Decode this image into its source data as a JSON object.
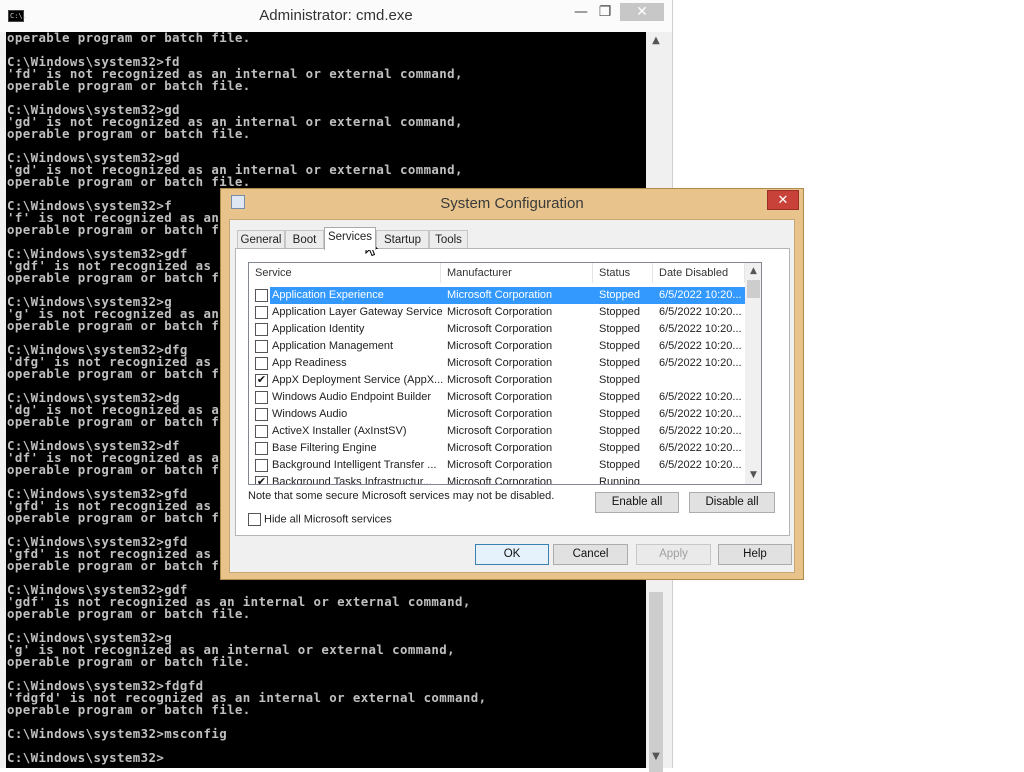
{
  "cmd": {
    "title": "Administrator: cmd.exe",
    "icon_text": "C:\\.",
    "minimize_glyph": "—",
    "maximize_glyph": "❐",
    "close_glyph": "✕",
    "lines": [
      "operable program or batch file.",
      "",
      "C:\\Windows\\system32>fd",
      "'fd' is not recognized as an internal or external command,",
      "operable program or batch file.",
      "",
      "C:\\Windows\\system32>gd",
      "'gd' is not recognized as an internal or external command,",
      "operable program or batch file.",
      "",
      "C:\\Windows\\system32>gd",
      "'gd' is not recognized as an internal or external command,",
      "operable program or batch file.",
      "",
      "C:\\Windows\\system32>f",
      "'f' is not recognized as an internal or external command,",
      "operable program or batch file.",
      "",
      "C:\\Windows\\system32>gdf",
      "'gdf' is not recognized as an internal or external command,",
      "operable program or batch file.",
      "",
      "C:\\Windows\\system32>g",
      "'g' is not recognized as an internal or external command,",
      "operable program or batch file.",
      "",
      "C:\\Windows\\system32>dfg",
      "'dfg' is not recognized as an internal or external command,",
      "operable program or batch file.",
      "",
      "C:\\Windows\\system32>dg",
      "'dg' is not recognized as an internal or external command,",
      "operable program or batch file.",
      "",
      "C:\\Windows\\system32>df",
      "'df' is not recognized as an internal or external command,",
      "operable program or batch file.",
      "",
      "C:\\Windows\\system32>gfd",
      "'gfd' is not recognized as an internal or external command,",
      "operable program or batch file.",
      "",
      "C:\\Windows\\system32>gfd",
      "'gfd' is not recognized as an internal or external command,",
      "operable program or batch file.",
      "",
      "C:\\Windows\\system32>gdf",
      "'gdf' is not recognized as an internal or external command,",
      "operable program or batch file.",
      "",
      "C:\\Windows\\system32>g",
      "'g' is not recognized as an internal or external command,",
      "operable program or batch file.",
      "",
      "C:\\Windows\\system32>fdgfd",
      "'fdgfd' is not recognized as an internal or external command,",
      "operable program or batch file.",
      "",
      "C:\\Windows\\system32>msconfig",
      "",
      "C:\\Windows\\system32>"
    ]
  },
  "msconfig": {
    "title": "System Configuration",
    "close_glyph": "✕",
    "tabs": [
      {
        "label": "General",
        "active": false
      },
      {
        "label": "Boot",
        "active": false
      },
      {
        "label": "Services",
        "active": true
      },
      {
        "label": "Startup",
        "active": false
      },
      {
        "label": "Tools",
        "active": false
      }
    ],
    "columns": [
      "Service",
      "Manufacturer",
      "Status",
      "Date Disabled"
    ],
    "services": [
      {
        "name": "Application Experience",
        "manufacturer": "Microsoft Corporation",
        "status": "Stopped",
        "date": "6/5/2022 10:20...",
        "checked": false,
        "selected": true
      },
      {
        "name": "Application Layer Gateway Service",
        "manufacturer": "Microsoft Corporation",
        "status": "Stopped",
        "date": "6/5/2022 10:20...",
        "checked": false,
        "selected": false
      },
      {
        "name": "Application Identity",
        "manufacturer": "Microsoft Corporation",
        "status": "Stopped",
        "date": "6/5/2022 10:20...",
        "checked": false,
        "selected": false
      },
      {
        "name": "Application Management",
        "manufacturer": "Microsoft Corporation",
        "status": "Stopped",
        "date": "6/5/2022 10:20...",
        "checked": false,
        "selected": false
      },
      {
        "name": "App Readiness",
        "manufacturer": "Microsoft Corporation",
        "status": "Stopped",
        "date": "6/5/2022 10:20...",
        "checked": false,
        "selected": false
      },
      {
        "name": "AppX Deployment Service (AppX...",
        "manufacturer": "Microsoft Corporation",
        "status": "Stopped",
        "date": "",
        "checked": true,
        "selected": false
      },
      {
        "name": "Windows Audio Endpoint Builder",
        "manufacturer": "Microsoft Corporation",
        "status": "Stopped",
        "date": "6/5/2022 10:20...",
        "checked": false,
        "selected": false
      },
      {
        "name": "Windows Audio",
        "manufacturer": "Microsoft Corporation",
        "status": "Stopped",
        "date": "6/5/2022 10:20...",
        "checked": false,
        "selected": false
      },
      {
        "name": "ActiveX Installer (AxInstSV)",
        "manufacturer": "Microsoft Corporation",
        "status": "Stopped",
        "date": "6/5/2022 10:20...",
        "checked": false,
        "selected": false
      },
      {
        "name": "Base Filtering Engine",
        "manufacturer": "Microsoft Corporation",
        "status": "Stopped",
        "date": "6/5/2022 10:20...",
        "checked": false,
        "selected": false
      },
      {
        "name": "Background Intelligent Transfer ...",
        "manufacturer": "Microsoft Corporation",
        "status": "Stopped",
        "date": "6/5/2022 10:20...",
        "checked": false,
        "selected": false
      },
      {
        "name": "Background Tasks Infrastructur...",
        "manufacturer": "Microsoft Corporation",
        "status": "Running",
        "date": "",
        "checked": true,
        "selected": false
      }
    ],
    "note": "Note that some secure Microsoft services may not be disabled.",
    "enable_all": "Enable all",
    "disable_all": "Disable all",
    "hide_ms": "Hide all Microsoft services",
    "ok": "OK",
    "cancel": "Cancel",
    "apply": "Apply",
    "help": "Help",
    "check_glyph": "✔",
    "arrow_up": "▲",
    "arrow_down": "▼"
  }
}
